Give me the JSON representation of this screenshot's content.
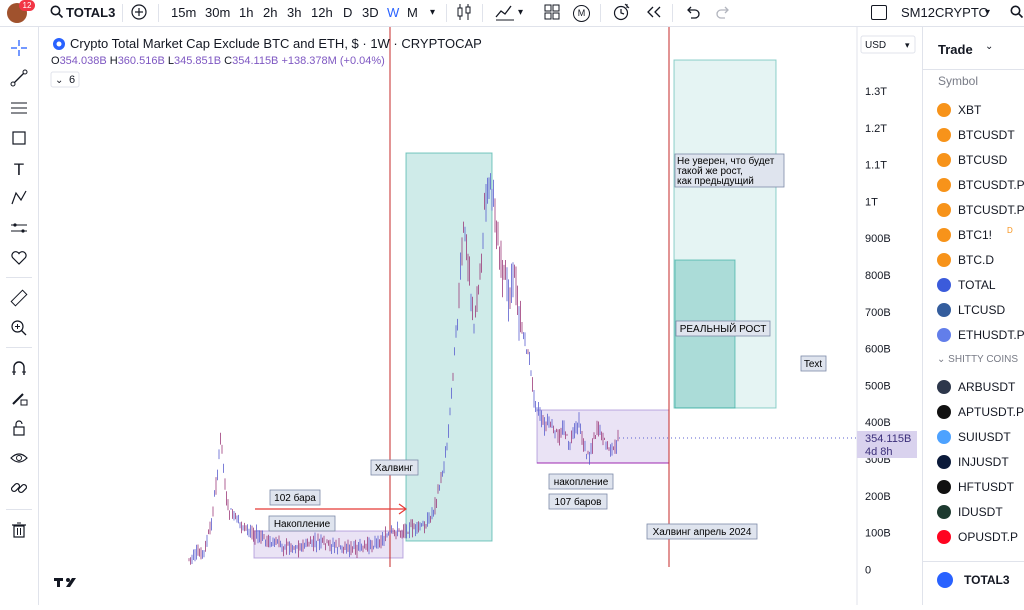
{
  "topbar": {
    "notifications": "12",
    "symbol": "TOTAL3",
    "intervals": [
      "15m",
      "30m",
      "1h",
      "2h",
      "3h",
      "12h",
      "D",
      "3D",
      "W",
      "M"
    ],
    "active_interval": "W",
    "replay_label": "M",
    "layout_name": "SM12CRYPTO",
    "colors": {
      "active": "#2962ff"
    }
  },
  "chart": {
    "title": "Crypto Total Market Cap Exclude BTC and ETH, $ · 1W · CRYPTOCAP",
    "ohlc": {
      "o_label": "O",
      "o": "354.038B",
      "h_label": "H",
      "h": "360.516B",
      "l_label": "L",
      "l": "345.851B",
      "c_label": "C",
      "c": "354.115B",
      "change": "+138.378M (+0.04%)"
    },
    "indicator_count": "6",
    "currency": "USD",
    "price_scale": [
      "1.3T",
      "1.2T",
      "1.1T",
      "1T",
      "900B",
      "800B",
      "700B",
      "600B",
      "500B",
      "400B",
      "300B",
      "200B",
      "100B",
      "0"
    ],
    "price_label": {
      "value": "354.115B",
      "countdown": "4d 8h"
    },
    "annotations": {
      "halving1": "Халвинг",
      "bars102": "102 бара",
      "accumulation1": "Накопление",
      "accumulation2": "накопление",
      "bars107": "107 баров",
      "halving2": "Халвинг апрель 2024",
      "not_sure": [
        "Не уверен, что будет",
        "такой же рост,",
        "как предыдущий"
      ],
      "real_growth": "РЕАЛЬНЫЙ РОСТ",
      "text": "Text"
    },
    "colors": {
      "candle_up": "#5b5fcf",
      "candle_down": "#9c3b7a",
      "green_box": "#26a69a",
      "purple_box": "#9575cd",
      "red_line": "#c62828"
    }
  },
  "watchlist": {
    "header": "Trade",
    "column": "Symbol",
    "items": [
      {
        "name": "XBT",
        "color": "#f7931a"
      },
      {
        "name": "BTCUSDT",
        "color": "#f7931a"
      },
      {
        "name": "BTCUSD",
        "color": "#f7931a"
      },
      {
        "name": "BTCUSDT.P",
        "color": "#f7931a"
      },
      {
        "name": "BTCUSDT.P",
        "color": "#f7931a"
      },
      {
        "name": "BTC1!",
        "color": "#f7931a",
        "badge": "D"
      },
      {
        "name": "BTC.D",
        "color": "#f7931a"
      },
      {
        "name": "TOTAL",
        "color": "#3b5bdb"
      },
      {
        "name": "LTCUSD",
        "color": "#345d9d"
      },
      {
        "name": "ETHUSDT.P",
        "color": "#627eea"
      }
    ],
    "section": "SHITTY COINS",
    "section_items": [
      {
        "name": "ARBUSDT",
        "color": "#2d374b"
      },
      {
        "name": "APTUSDT.P",
        "color": "#111111"
      },
      {
        "name": "SUIUSDT",
        "color": "#4da2ff"
      },
      {
        "name": "INJUSDT",
        "color": "#0b1a3a"
      },
      {
        "name": "HFTUSDT",
        "color": "#111111"
      },
      {
        "name": "IDUSDT",
        "color": "#1d3a2f"
      },
      {
        "name": "OPUSDT.P",
        "color": "#ff0420"
      }
    ],
    "footer": "TOTAL3"
  }
}
